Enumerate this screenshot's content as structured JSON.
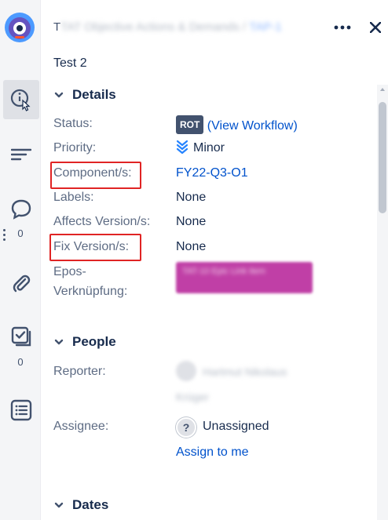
{
  "header": {
    "breadcrumb_prefix": "T",
    "breadcrumb_blurred": "TAT Objective Actions & Demands /",
    "breadcrumb_link_blurred": "TAP-1",
    "more_label": "•••",
    "close_label": "✕"
  },
  "issue": {
    "title": "Test 2"
  },
  "rail": {
    "comments_count": "0",
    "checklist_count": "0"
  },
  "details": {
    "section_title": "Details",
    "status_label": "Status:",
    "status_lozenge": "ROT",
    "status_paren_open": "(",
    "status_link": "View Workflow",
    "status_paren_close": ")",
    "priority_label": "Priority:",
    "priority_value": "Minor",
    "component_label": "Component/s:",
    "component_value": "FY22-Q3-O1",
    "labels_label": "Labels:",
    "labels_value": "None",
    "affects_label": "Affects Version/s:",
    "affects_value": "None",
    "fix_label": "Fix Version/s:",
    "fix_value": "None",
    "epos_label_1": "Epos-",
    "epos_label_2": "Verknüpfung:",
    "epos_blurred": "TAT-10 Epic Link item"
  },
  "people": {
    "section_title": "People",
    "reporter_label": "Reporter:",
    "reporter_blurred_1": "Hartmut Nikolaus",
    "reporter_blurred_2": "Krüger",
    "assignee_label": "Assignee:",
    "assignee_value": "Unassigned",
    "assign_link": "Assign to me"
  },
  "dates": {
    "section_title": "Dates"
  },
  "colors": {
    "accent": "#0052cc",
    "highlight": "#e02424",
    "lozenge": "#42526e",
    "priority": "#2684ff"
  },
  "icons": {
    "info": "info-icon",
    "summary": "lines-icon",
    "comments": "comment-icon",
    "attachments": "paperclip-icon",
    "checklist": "checklist-icon",
    "list": "list-icon"
  }
}
